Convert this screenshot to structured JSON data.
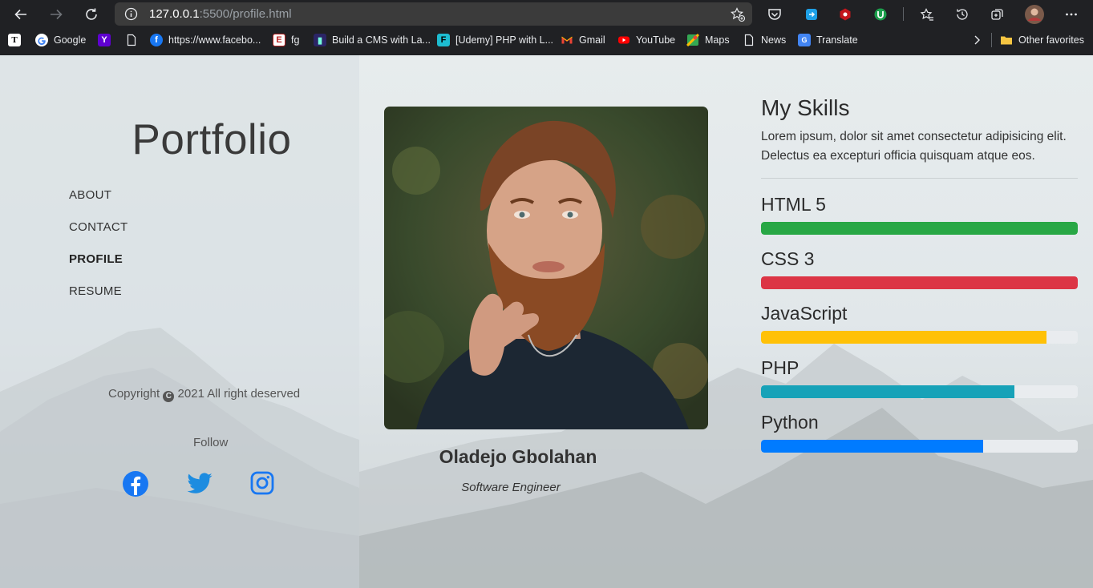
{
  "browser": {
    "url_host": "127.0.0.1",
    "url_rest": ":5500/profile.html",
    "bookmarks": [
      {
        "label": "",
        "icon": "t-icon"
      },
      {
        "label": "Google",
        "icon": "google-icon"
      },
      {
        "label": "",
        "icon": "yahoo-icon"
      },
      {
        "label": "",
        "icon": "page-icon"
      },
      {
        "label": "https://www.facebo...",
        "icon": "facebook-icon"
      },
      {
        "label": "fg",
        "icon": "fg-icon"
      },
      {
        "label": "Build a CMS with La...",
        "icon": "cms-icon"
      },
      {
        "label": "[Udemy] PHP with L...",
        "icon": "udemy-icon"
      },
      {
        "label": "Gmail",
        "icon": "gmail-icon"
      },
      {
        "label": "YouTube",
        "icon": "youtube-icon"
      },
      {
        "label": "Maps",
        "icon": "maps-icon"
      },
      {
        "label": "News",
        "icon": "page-icon"
      },
      {
        "label": "Translate",
        "icon": "translate-icon"
      }
    ],
    "other_favorites": "Other favorites"
  },
  "sidebar": {
    "brand": "Portfolio",
    "nav": [
      {
        "label": "ABOUT",
        "active": false
      },
      {
        "label": "CONTACT",
        "active": false
      },
      {
        "label": "PROFILE",
        "active": true
      },
      {
        "label": "RESUME",
        "active": false
      }
    ],
    "copyright_prefix": "Copyright",
    "copyright_symbol": "C",
    "copyright_suffix": "2021 All right deserved",
    "follow": "Follow",
    "social": [
      "facebook-icon",
      "twitter-icon",
      "instagram-icon"
    ]
  },
  "profile": {
    "name": "Oladejo Gbolahan",
    "title": "Software Engineer"
  },
  "skills": {
    "title": "My Skills",
    "description": "Lorem ipsum, dolor sit amet consectetur adipisicing elit. Delectus ea excepturi officia quisquam atque eos.",
    "items": [
      {
        "name": "HTML 5",
        "level": 1.0,
        "color": "#28a745"
      },
      {
        "name": "CSS 3",
        "level": 1.0,
        "color": "#dc3545"
      },
      {
        "name": "JavaScript",
        "level": 0.9,
        "color": "#ffc107"
      },
      {
        "name": "PHP",
        "level": 0.8,
        "color": "#17a2b8"
      },
      {
        "name": "Python",
        "level": 0.7,
        "color": "#007bff"
      }
    ]
  }
}
